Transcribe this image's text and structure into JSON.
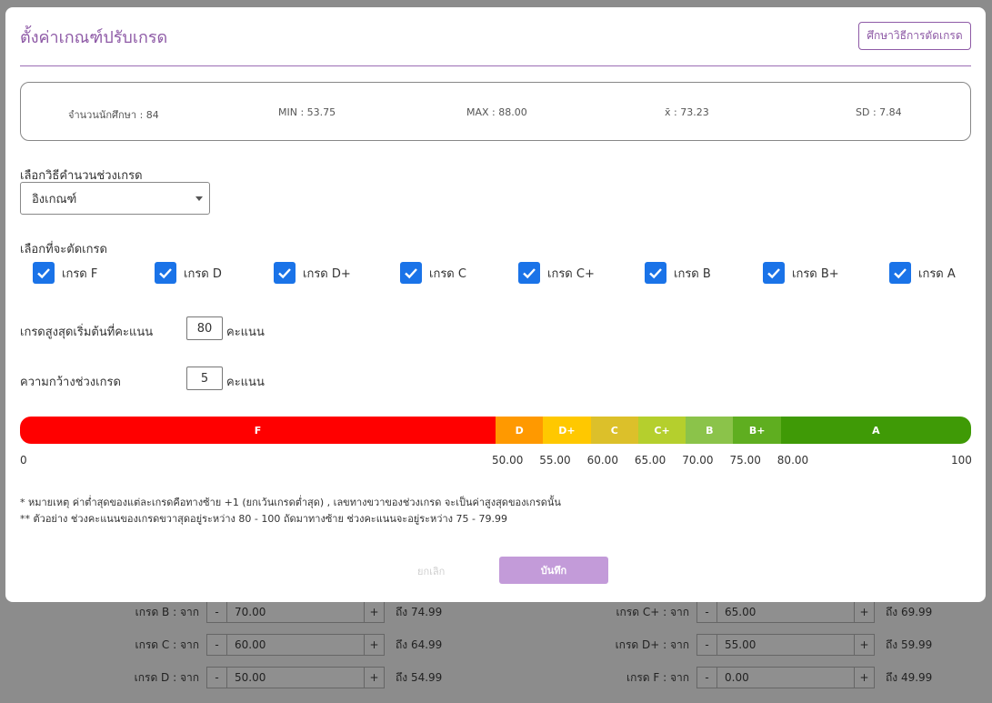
{
  "modal": {
    "title": "ตั้งค่าเกณฑ์ปรับเกรด",
    "guide_button": "ศึกษาวิธีการตัดเกรด"
  },
  "stats": {
    "students": "จำนวนนักศึกษา : 84",
    "min": "MIN : 53.75",
    "max": "MAX : 88.00",
    "mean": "x̄ : 73.23",
    "sd": "SD : 7.84"
  },
  "method": {
    "label": "เลือกวิธีคำนวนช่วงเกรด",
    "selected": "อิงเกณฑ์"
  },
  "grades_select": {
    "label": "เลือกที่จะตัดเกรด",
    "items": [
      {
        "label": "เกรด F",
        "checked": true
      },
      {
        "label": "เกรด D",
        "checked": true
      },
      {
        "label": "เกรด D+",
        "checked": true
      },
      {
        "label": "เกรด C",
        "checked": true
      },
      {
        "label": "เกรด C+",
        "checked": true
      },
      {
        "label": "เกรด B",
        "checked": true
      },
      {
        "label": "เกรด B+",
        "checked": true
      },
      {
        "label": "เกรด A",
        "checked": true
      }
    ]
  },
  "max_grade_start": {
    "label": "เกรดสูงสุดเริ่มต้นที่คะแนน",
    "value": "80",
    "unit": "คะแนน"
  },
  "range_width": {
    "label": "ความกว้างช่วงเกรด",
    "value": "5",
    "unit": "คะแนน"
  },
  "grade_bar": {
    "segments": [
      {
        "label": "F",
        "from": 0,
        "to": 50,
        "color": "#ff0000"
      },
      {
        "label": "D",
        "from": 50,
        "to": 55,
        "color": "#ff9900"
      },
      {
        "label": "D+",
        "from": 55,
        "to": 60,
        "color": "#ffc800"
      },
      {
        "label": "C",
        "from": 60,
        "to": 65,
        "color": "#dcc02a"
      },
      {
        "label": "C+",
        "from": 65,
        "to": 70,
        "color": "#b5cf2d"
      },
      {
        "label": "B",
        "from": 70,
        "to": 75,
        "color": "#8bc34a"
      },
      {
        "label": "B+",
        "from": 75,
        "to": 80,
        "color": "#5fae20"
      },
      {
        "label": "A",
        "from": 80,
        "to": 100,
        "color": "#3f9a06"
      }
    ],
    "ticks": [
      "0",
      "50.00",
      "55.00",
      "60.00",
      "65.00",
      "70.00",
      "75.00",
      "80.00",
      "100"
    ]
  },
  "notes": {
    "note1": "* หมายเหตุ ค่าต่ำสุดของแต่ละเกรดคือทางซ้าย +1 (ยกเว้นเกรดต่ำสุด) , เลขทางขวาของช่วงเกรด จะเป็นค่าสูงสุดของเกรดนั้น",
    "note2": "** ตัวอย่าง ช่วงคะแนนของเกรดขวาสุดอยู่ระหว่าง 80 - 100 ถัดมาทางซ้าย ช่วงคะแนนจะอยู่ระหว่าง 75 - 79.99"
  },
  "actions": {
    "cancel": "ยกเลิก",
    "save": "บันทึก"
  },
  "background_rows": [
    {
      "label": "เกรด B : จาก",
      "value": "70.00",
      "to": "ถึง 74.99"
    },
    {
      "label": "เกรด C+ : จาก",
      "value": "65.00",
      "to": "ถึง 69.99"
    },
    {
      "label": "เกรด C : จาก",
      "value": "60.00",
      "to": "ถึง 64.99"
    },
    {
      "label": "เกรด D+ : จาก",
      "value": "55.00",
      "to": "ถึง 59.99"
    },
    {
      "label": "เกรด D : จาก",
      "value": "50.00",
      "to": "ถึง 54.99"
    },
    {
      "label": "เกรด F : จาก",
      "value": "0.00",
      "to": "ถึง 49.99"
    }
  ],
  "stepper": {
    "minus": "-",
    "plus": "+"
  }
}
